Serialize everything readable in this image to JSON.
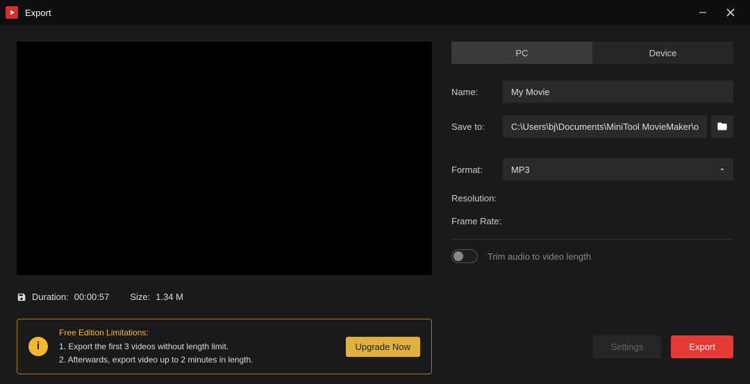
{
  "window": {
    "title": "Export"
  },
  "tabs": {
    "pc": "PC",
    "device": "Device"
  },
  "form": {
    "name_label": "Name:",
    "name_value": "My Movie",
    "saveto_label": "Save to:",
    "saveto_value": "C:\\Users\\bj\\Documents\\MiniTool MovieMaker\\outp",
    "format_label": "Format:",
    "format_value": "MP3",
    "resolution_label": "Resolution:",
    "framerate_label": "Frame Rate:",
    "trim_label": "Trim audio to video length"
  },
  "info": {
    "duration_label": "Duration:",
    "duration_value": "00:00:57",
    "size_label": "Size:",
    "size_value": "1.34 M"
  },
  "limitations": {
    "heading": "Free Edition Limitations:",
    "line1": "1. Export the first 3 videos without length limit.",
    "line2": "2. Afterwards, export video up to 2 minutes in length.",
    "upgrade": "Upgrade Now"
  },
  "buttons": {
    "settings": "Settings",
    "export": "Export"
  }
}
